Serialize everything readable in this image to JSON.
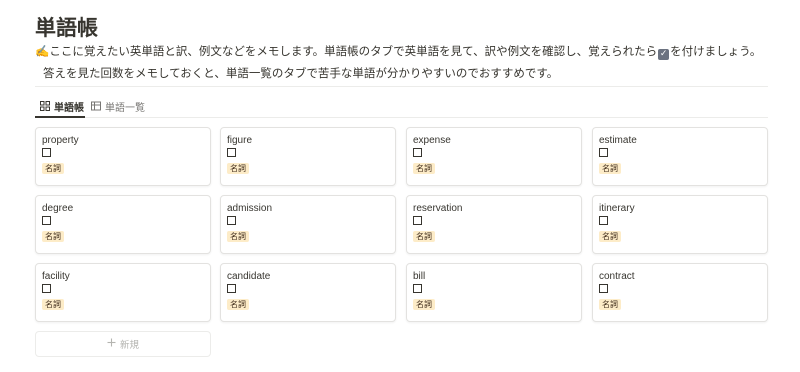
{
  "page": {
    "title": "単語帳",
    "description_emoji": "✍️",
    "description_line1_part1": "ここに覚えたい英単語と訳、例文などをメモします。単語帳のタブで英単語を見て、訳や例文を確認し、覚えられたら",
    "description_check_glyph": "✓",
    "description_line1_part2": "を付けましょう。",
    "description_line2": "答えを見た回数をメモしておくと、単語一覧のタブで苦手な単語が分かりやすいのでおすすめです。"
  },
  "tabs": [
    {
      "label": "単語帳",
      "icon": "gallery-icon",
      "active": true
    },
    {
      "label": "単語一覧",
      "icon": "table-icon",
      "active": false
    }
  ],
  "cards": [
    {
      "word": "property",
      "tag": "名詞",
      "checked": false
    },
    {
      "word": "figure",
      "tag": "名詞",
      "checked": false
    },
    {
      "word": "expense",
      "tag": "名詞",
      "checked": false
    },
    {
      "word": "estimate",
      "tag": "名詞",
      "checked": false
    },
    {
      "word": "degree",
      "tag": "名詞",
      "checked": false
    },
    {
      "word": "admission",
      "tag": "名詞",
      "checked": false
    },
    {
      "word": "reservation",
      "tag": "名詞",
      "checked": false
    },
    {
      "word": "itinerary",
      "tag": "名詞",
      "checked": false
    },
    {
      "word": "facility",
      "tag": "名詞",
      "checked": false
    },
    {
      "word": "candidate",
      "tag": "名詞",
      "checked": false
    },
    {
      "word": "bill",
      "tag": "名詞",
      "checked": false
    },
    {
      "word": "contract",
      "tag": "名詞",
      "checked": false
    }
  ],
  "new_button": {
    "label": "新規",
    "icon": "plus-icon"
  },
  "colors": {
    "tag_background": "#fdecc8",
    "tag_text": "#402c1b",
    "text": "#37352f",
    "muted": "#787774"
  }
}
